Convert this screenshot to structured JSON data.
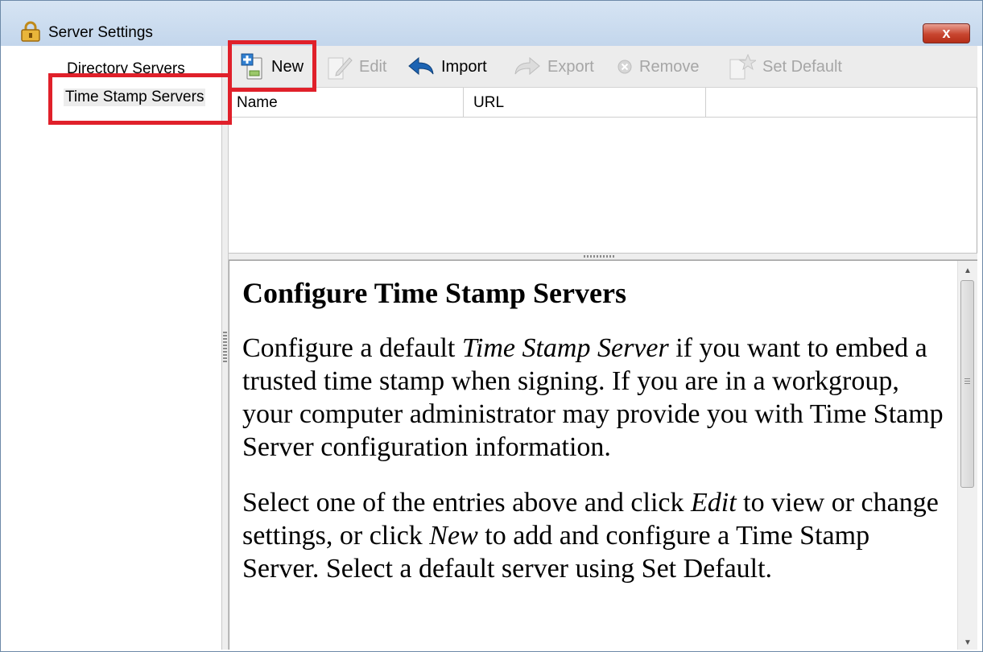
{
  "window": {
    "title": "Server Settings",
    "close_label": "x"
  },
  "sidebar": {
    "items": [
      {
        "label": "Directory Servers"
      },
      {
        "label": "Time Stamp Servers"
      }
    ]
  },
  "toolbar": {
    "new_label": "New",
    "edit_label": "Edit",
    "import_label": "Import",
    "export_label": "Export",
    "remove_label": "Remove",
    "set_default_label": "Set Default"
  },
  "table": {
    "columns": [
      "Name",
      "URL"
    ]
  },
  "help": {
    "heading": "Configure Time Stamp Servers",
    "p1_a": "Configure a default ",
    "p1_em": "Time Stamp Server",
    "p1_b": " if you want to embed a trusted time stamp when signing. If you are in a workgroup, your computer administrator may provide you with Time Stamp Server configuration information.",
    "p2_a": "Select one of the entries above and click ",
    "p2_em1": "Edit",
    "p2_b": " to view or change settings, or click ",
    "p2_em2": "New",
    "p2_c": " to add and configure a Time Stamp Server. Select a default server using Set Default."
  },
  "colors": {
    "highlight": "#e0202a",
    "titlebar": "#c3d6ec",
    "close": "#c8452f"
  }
}
